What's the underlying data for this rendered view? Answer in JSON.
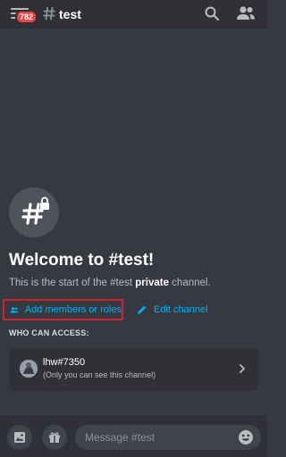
{
  "header": {
    "notification_count": "782",
    "channel_name": "test"
  },
  "welcome": {
    "title": "Welcome to #test!",
    "subtitle_before": "This is the start of the #test ",
    "subtitle_bold": "private",
    "subtitle_after": " channel."
  },
  "actions": {
    "add_members_label": "Add members or roles",
    "edit_channel_label": "Edit channel"
  },
  "access": {
    "heading": "WHO CAN ACCESS:",
    "user_name": "lhw#7350",
    "user_note": "(Only you can see this channel)"
  },
  "composer": {
    "placeholder": "Message #test"
  },
  "colors": {
    "background": "#36393f",
    "bar": "#2f3136",
    "link": "#00aff4",
    "badge": "#ed4245",
    "highlight_border": "#d1232d"
  },
  "icons": {
    "menu": "hamburger-menu-icon",
    "channel": "hash-icon",
    "search": "search-icon",
    "members": "members-icon",
    "private": "lock-icon",
    "add_members": "add-person-icon",
    "edit": "pencil-icon",
    "chevron": "chevron-right-icon",
    "image": "image-icon",
    "gift": "gift-icon",
    "emoji": "emoji-icon"
  }
}
